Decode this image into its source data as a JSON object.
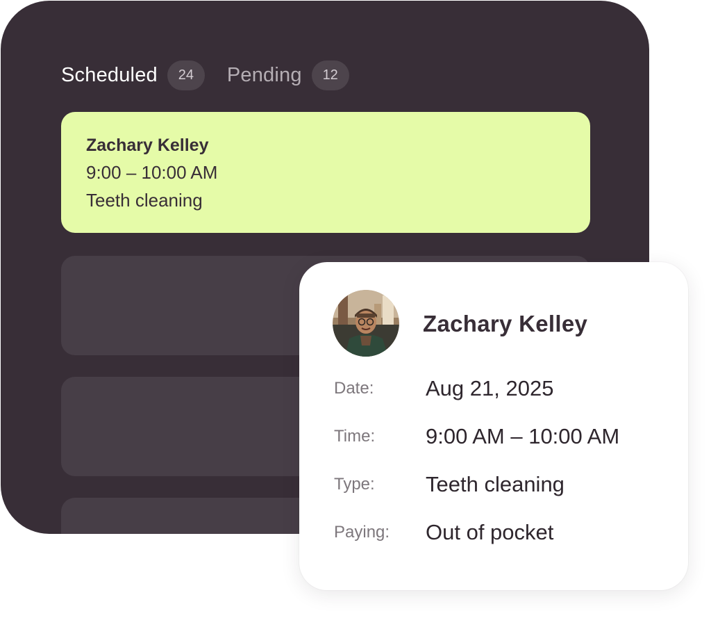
{
  "tabs": [
    {
      "label": "Scheduled",
      "count": "24",
      "active": true
    },
    {
      "label": "Pending",
      "count": "12",
      "active": false
    }
  ],
  "selected_appointment": {
    "name": "Zachary Kelley",
    "time": "9:00 – 10:00 AM",
    "type": "Teeth cleaning"
  },
  "detail": {
    "name": "Zachary Kelley",
    "rows": [
      {
        "key": "Date:",
        "value": "Aug 21, 2025"
      },
      {
        "key": "Time:",
        "value": "9:00 AM – 10:00 AM"
      },
      {
        "key": "Type:",
        "value": "Teeth cleaning"
      },
      {
        "key": "Paying:",
        "value": "Out of pocket"
      }
    ]
  },
  "colors": {
    "panel": "#382e37",
    "active_card": "#e5fba8",
    "placeholder_card": "#473e47",
    "badge": "#4d444c"
  },
  "icons": {
    "avatar": "user-avatar-photo"
  }
}
